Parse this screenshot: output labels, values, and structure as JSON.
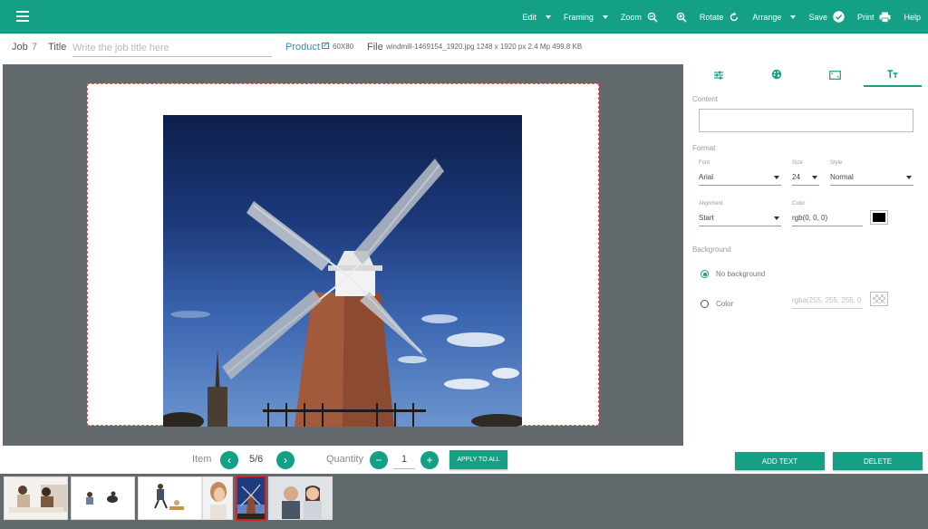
{
  "toolbar": {
    "menu_icon": "hamburger-icon",
    "items": [
      {
        "label": "Edit",
        "icon": "caret-down"
      },
      {
        "label": "Framing",
        "icon": "caret-down"
      },
      {
        "label": "Zoom",
        "icon": "zoom-out-icon"
      },
      {
        "label": "",
        "icon": "zoom-in-icon"
      },
      {
        "label": "Rotate",
        "icon": "rotate-icon"
      },
      {
        "label": "Arrange",
        "icon": "caret-down"
      },
      {
        "label": "Save",
        "icon": "check-circle-icon"
      },
      {
        "label": "Print",
        "icon": "printer-icon"
      },
      {
        "label": "Help",
        "icon": "help-icon"
      }
    ],
    "bg_color": "#14a085"
  },
  "job": {
    "job_label": "Job",
    "job_number": "7",
    "title_label": "Title",
    "title_placeholder": "Write the job title here",
    "product_label": "Product",
    "product_size": "60X80",
    "file_label": "File",
    "file_info": "windmill-1469154_1920.jpg 1248 x 1920 px 2.4 Mp 499.8 KB"
  },
  "item_nav": {
    "item_label": "Item",
    "item_position": "5/6",
    "quantity_label": "Quantity",
    "quantity_value": "1",
    "apply_label": "APPLY TO ALL"
  },
  "panel": {
    "tabs": [
      "adjust-icon",
      "palette-icon",
      "frame-icon",
      "text-icon"
    ],
    "active_tab": 3,
    "content_label": "Content",
    "content_value": "",
    "format_label": "Format",
    "font_label": "Font",
    "font_value": "Arial",
    "size_label": "Size",
    "size_value": "24",
    "style_label": "Style",
    "style_value": "Normal",
    "alignment_label": "Alignment",
    "alignment_value": "Start",
    "color_label": "Color",
    "color_value": "rgb(0, 0, 0)",
    "background_label": "Background",
    "no_background_label": "No background",
    "color_option_label": "Color",
    "bg_color_value": "rgba(255, 255, 255, 0",
    "add_text_label": "ADD TEXT",
    "delete_label": "DELETE"
  },
  "thumbnails": [
    {
      "name": "family-on-sofa",
      "selected": false
    },
    {
      "name": "toys-on-floor",
      "selected": false
    },
    {
      "name": "child-with-sled",
      "selected": false
    },
    {
      "name": "woman-portrait",
      "selected": false
    },
    {
      "name": "windmill",
      "selected": true
    },
    {
      "name": "couple-portrait",
      "selected": false
    }
  ],
  "colors": {
    "accent": "#14a085",
    "canvas_bg": "#626a6d",
    "page_border": "#e25a5a",
    "selected_thumb_border": "#d0232a"
  }
}
